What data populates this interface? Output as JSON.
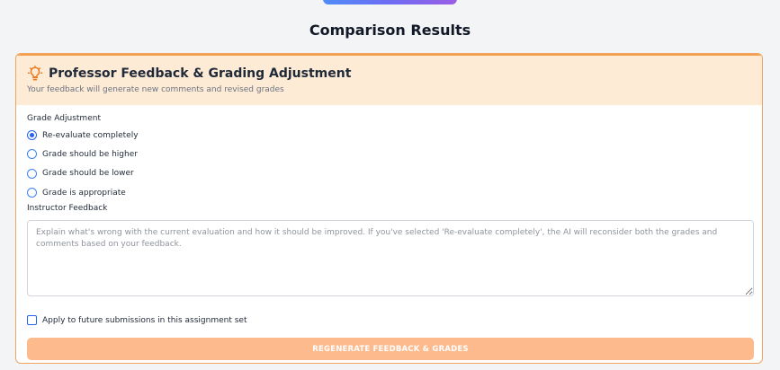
{
  "page": {
    "title": "Comparison Results"
  },
  "feedback_card": {
    "title": "Professor Feedback & Grading Adjustment",
    "subtitle": "Your feedback will generate new comments and revised grades",
    "icon": "lightbulb-icon",
    "accent_color": "#f59e4b",
    "header_bg": "#fdebd6",
    "grade_adjustment": {
      "label": "Grade Adjustment",
      "options": [
        {
          "label": "Re-evaluate completely",
          "checked": true
        },
        {
          "label": "Grade should be higher",
          "checked": false
        },
        {
          "label": "Grade should be lower",
          "checked": false
        },
        {
          "label": "Grade is appropriate",
          "checked": false
        }
      ]
    },
    "instructor_feedback": {
      "label": "Instructor Feedback",
      "value": "",
      "placeholder": "Explain what's wrong with the current evaluation and how it should be improved. If you've selected 'Re-evaluate completely', the AI will reconsider both the grades and comments based on your feedback."
    },
    "apply_future": {
      "label": "Apply to future submissions in this assignment set",
      "checked": false
    },
    "submit_button": {
      "label": "REGENERATE FEEDBACK & GRADES",
      "color": "#fdba8c"
    }
  }
}
